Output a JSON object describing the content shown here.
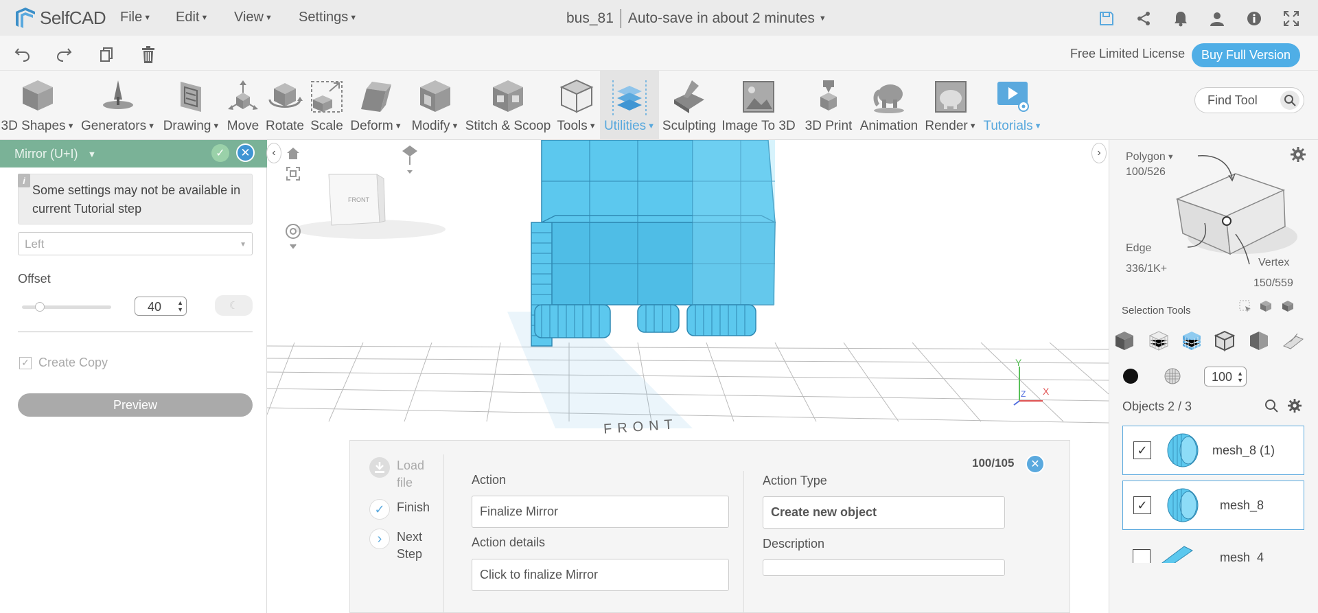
{
  "app": {
    "logo_text": "SelfCAD",
    "menus": [
      "File",
      "Edit",
      "View",
      "Settings"
    ],
    "project_name": "bus_81",
    "autosave": "Auto-save in about 2 minutes",
    "license_text": "Free Limited License",
    "buy_label": "Buy Full Version"
  },
  "toolbar": {
    "tools": [
      {
        "label": "3D Shapes",
        "dropdown": true
      },
      {
        "label": "Generators",
        "dropdown": true
      },
      {
        "label": "Drawing",
        "dropdown": true
      },
      {
        "label": "Move",
        "dropdown": false
      },
      {
        "label": "Rotate",
        "dropdown": false
      },
      {
        "label": "Scale",
        "dropdown": false
      },
      {
        "label": "Deform",
        "dropdown": true
      },
      {
        "label": "Modify",
        "dropdown": true
      },
      {
        "label": "Stitch & Scoop",
        "dropdown": false
      },
      {
        "label": "Tools",
        "dropdown": true
      },
      {
        "label": "Utilities",
        "dropdown": true
      },
      {
        "label": "Sculpting",
        "dropdown": false
      },
      {
        "label": "Image To 3D",
        "dropdown": false
      },
      {
        "label": "3D Print",
        "dropdown": false
      },
      {
        "label": "Animation",
        "dropdown": false
      },
      {
        "label": "Render",
        "dropdown": true
      },
      {
        "label": "Tutorials",
        "dropdown": true
      }
    ],
    "find_tool_placeholder": "Find Tool"
  },
  "left_panel": {
    "title": "Mirror (U+I)",
    "notice": "Some settings may not be available in current Tutorial step",
    "direction_value": "Left",
    "offset_label": "Offset",
    "offset_value": "40",
    "offset_slider_fraction": 0.2,
    "create_copy_label": "Create Copy",
    "create_copy_checked": true,
    "preview_label": "Preview"
  },
  "viewport": {
    "cube_label": "FRONT",
    "ground_label": "FRONT",
    "axis_y": "Y",
    "axis_z": "Z",
    "axis_x": "X",
    "model_color": "#5cc8ee"
  },
  "tutorial": {
    "steps": [
      {
        "label": "Load file",
        "state": "disabled"
      },
      {
        "label": "Finish",
        "state": "done"
      },
      {
        "label": "Next Step",
        "state": "next"
      }
    ],
    "action_label": "Action",
    "action_value": "Finalize Mirror",
    "details_label": "Action details",
    "details_value": "Click to finalize Mirror",
    "type_label": "Action Type",
    "type_value": "Create new object",
    "description_label": "Description",
    "description_value": "",
    "progress": "100/105"
  },
  "right_panel": {
    "polygon_label": "Polygon",
    "polygon_count": "100/526",
    "edge_label": "Edge",
    "edge_count": "336/1K+",
    "vertex_label": "Vertex",
    "vertex_count": "150/559",
    "selection_tools_label": "Selection Tools",
    "opacity_value": "100",
    "objects_label": "Objects 2 / 3",
    "objects": [
      {
        "name": "mesh_8 (1)",
        "checked": true,
        "selected": true
      },
      {
        "name": "mesh_8",
        "checked": true,
        "selected": true
      },
      {
        "name": "mesh_4",
        "checked": false,
        "selected": false
      }
    ]
  },
  "colors": {
    "accent": "#4faee6",
    "panel_header": "#7ab297",
    "model": "#5cc8ee"
  }
}
